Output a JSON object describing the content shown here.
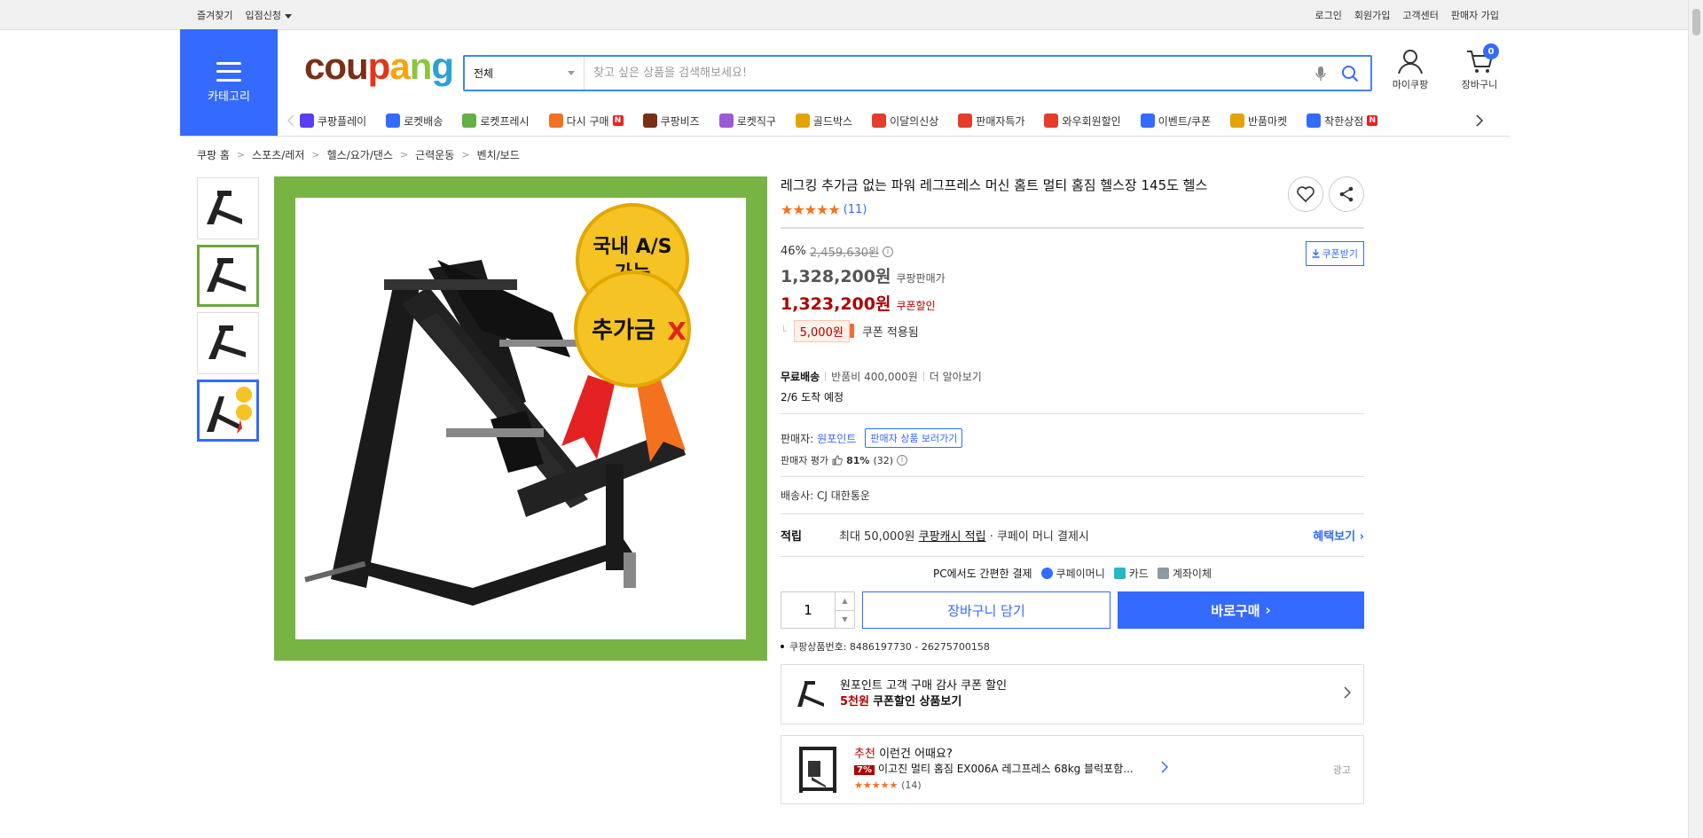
{
  "topbar": {
    "bookmark": "즐겨찾기",
    "seller_apply": "입점신청",
    "login": "로그인",
    "signup": "회원가입",
    "customer_center": "고객센터",
    "seller_signup": "판매자 가입"
  },
  "header": {
    "category_label": "카테고리",
    "logo": [
      "cou",
      "p",
      "a",
      "n",
      "g"
    ],
    "search_select": "전체",
    "search_placeholder": "찾고 싶은 상품을 검색해보세요!",
    "my_coupang": "마이쿠팡",
    "cart": "장바구니",
    "cart_count": "0"
  },
  "menu": [
    {
      "label": "쿠팡플레이",
      "color": "#5b3df5",
      "badge": ""
    },
    {
      "label": "로켓배송",
      "color": "#346aff",
      "badge": ""
    },
    {
      "label": "로켓프레시",
      "color": "#63b144",
      "badge": ""
    },
    {
      "label": "다시 구매",
      "color": "#f4711f",
      "badge": "N"
    },
    {
      "label": "쿠팡비즈",
      "color": "#7b2e17",
      "badge": ""
    },
    {
      "label": "로켓직구",
      "color": "#9b59d6",
      "badge": ""
    },
    {
      "label": "골드박스",
      "color": "#e2a500",
      "badge": ""
    },
    {
      "label": "이달의신상",
      "color": "#e53c2c",
      "badge": ""
    },
    {
      "label": "판매자특가",
      "color": "#e53c2c",
      "badge": ""
    },
    {
      "label": "와우회원할인",
      "color": "#e53c2c",
      "badge": ""
    },
    {
      "label": "이벤트/쿠폰",
      "color": "#346aff",
      "badge": ""
    },
    {
      "label": "반품마켓",
      "color": "#e2a500",
      "badge": ""
    },
    {
      "label": "착한상점",
      "color": "#346aff",
      "badge": "N"
    }
  ],
  "breadcrumb": [
    "쿠팡 홈",
    "스포츠/레저",
    "헬스/요가/댄스",
    "근력운동",
    "벤치/보드"
  ],
  "product": {
    "title": "레그킹 추가금 없는 파워 레그프레스 머신 홈트 멀티 홈짐 헬스장 145도 헬스",
    "rating": 5,
    "review_count": "(11)",
    "discount_pct": "46%",
    "original_price": "2,459,630원",
    "coupon_download": "쿠폰받기",
    "price": "1,328,200원",
    "price_label": "쿠팡판매가",
    "coupon_price": "1,323,200원",
    "coupon_price_label": "쿠폰할인",
    "coupon_amount": "5,000원",
    "coupon_applied": "쿠폰 적용됨",
    "image_badge_1": "국내 A/S\n가능",
    "image_badge_2": "추가금X"
  },
  "shipping": {
    "free": "무료배송",
    "return_fee": "반품비 400,000원",
    "more": "더 알아보기",
    "eta": "2/6 도착 예정"
  },
  "seller": {
    "label": "판매자:",
    "name": "원포인트",
    "view_button": "판매자 상품 보러가기",
    "rating_label": "판매자 평가",
    "rating_pct": "81%",
    "rating_count": "(32)"
  },
  "delivery": {
    "label": "배송사:",
    "company": "CJ 대한통운"
  },
  "reward": {
    "label": "적립",
    "max": "최대 50,000원",
    "cash": "쿠팡캐시 적립",
    "pay": "· 쿠페이 머니 결제시",
    "benefit": "혜택보기"
  },
  "pc_pay": {
    "label": "PC에서도 간편한 결제",
    "methods": [
      {
        "label": "쿠페이머니",
        "color": "#346aff"
      },
      {
        "label": "카드",
        "color": "#25b8c5"
      },
      {
        "label": "계좌이체",
        "color": "#8e9aa6"
      }
    ]
  },
  "buy": {
    "qty": "1",
    "cart_btn": "장바구니 담기",
    "buy_btn": "바로구매"
  },
  "product_no": "쿠팡상품번호: 8486197730 - 26275700158",
  "promo": {
    "line1": "원포인트 고객 구매 감사 쿠폰 할인",
    "amount": "5천원",
    "line2": "쿠폰할인 상품보기"
  },
  "recommend": {
    "tag": "추천",
    "headline": "이런건 어때요?",
    "pct": "7%",
    "name": "이고진 멀티 홈짐 EX006A 레그프레스 68kg 블럭포함...",
    "review_count": "(14)",
    "ad": "광고"
  }
}
